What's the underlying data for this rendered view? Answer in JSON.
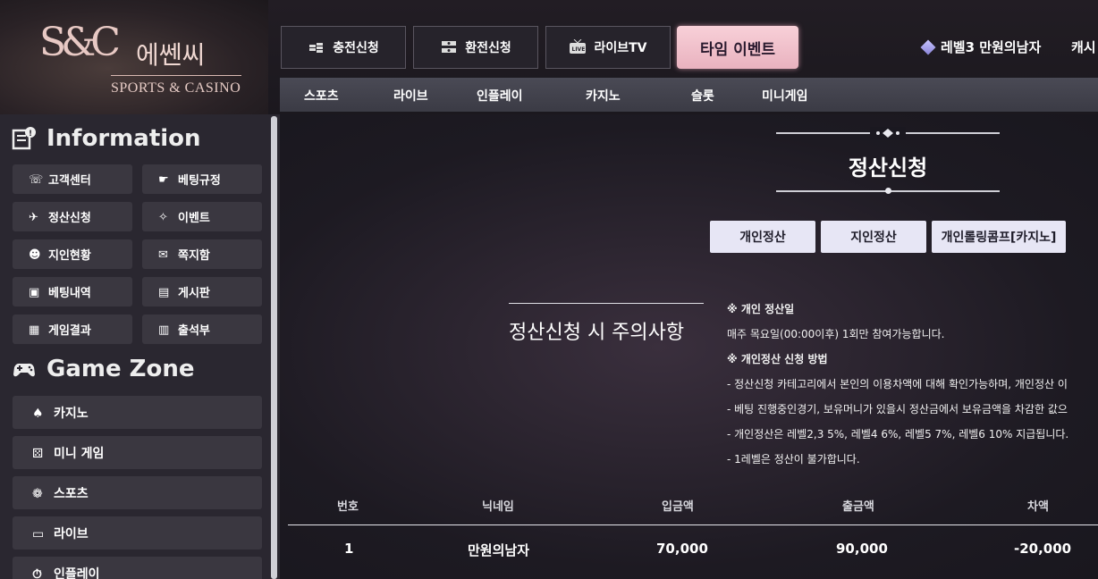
{
  "logo": {
    "mark": "S&C",
    "ko": "에쎈씨",
    "en": "SPORTS & CASINO"
  },
  "top_buttons": [
    {
      "label": "충전신청",
      "icon": "coin-stack-icon"
    },
    {
      "label": "환전신청",
      "icon": "exchange-icon"
    },
    {
      "label": "라이브TV",
      "icon": "live-tv-icon"
    }
  ],
  "time_event": "타임 이벤트",
  "user": {
    "level_name": "레벨3 만원의남자",
    "cash": "캐시"
  },
  "nav": [
    "스포츠",
    "라이브",
    "인플레이",
    "카지노",
    "슬롯",
    "미니게임"
  ],
  "sidebar": {
    "info_title": "Information",
    "info_items": [
      {
        "label": "고객센터",
        "icon": "phone-icon"
      },
      {
        "label": "베팅규정",
        "icon": "hand-icon"
      },
      {
        "label": "정산신청",
        "icon": "settlement-icon"
      },
      {
        "label": "이벤트",
        "icon": "party-icon"
      },
      {
        "label": "지인현황",
        "icon": "people-icon"
      },
      {
        "label": "쪽지함",
        "icon": "message-icon"
      },
      {
        "label": "베팅내역",
        "icon": "history-icon"
      },
      {
        "label": "게시판",
        "icon": "board-icon"
      },
      {
        "label": "게임결과",
        "icon": "result-icon"
      },
      {
        "label": "출석부",
        "icon": "calendar-icon"
      }
    ],
    "game_title": "Game Zone",
    "game_items": [
      {
        "label": "카지노",
        "icon": "spade-icon"
      },
      {
        "label": "미니 게임",
        "icon": "dice-icon"
      },
      {
        "label": "스포츠",
        "icon": "ball-icon"
      },
      {
        "label": "라이브",
        "icon": "monitor-icon"
      },
      {
        "label": "인플레이",
        "icon": "stopwatch-icon"
      }
    ]
  },
  "main": {
    "title": "정산신청",
    "tabs": [
      "개인정산",
      "지인정산",
      "개인롤링콤프[카지노]"
    ],
    "notice_head": "정산신청 시 주의사항",
    "notice_lines": [
      "※ 개인 정산일",
      "매주 목요일(00:00이후) 1회만 참여가능합니다.",
      "※ 개인정산 신청 방법",
      "- 정산신청 카테고리에서 본인의 이용차액에 대해 확인가능하며, 개인정산 이",
      "- 베팅 진행중인경기, 보유머니가 있을시 정산금에서 보유금액을 차감한 값으",
      "- 개인정산은 레벨2,3 5%, 레벨4 6%, 레벨5 7%, 레벨6 10% 지급됩니다.",
      "- 1레벨은 정산이 불가합니다."
    ],
    "table": {
      "headers": [
        "번호",
        "닉네임",
        "입금액",
        "출금액",
        "차액"
      ],
      "rows": [
        [
          "1",
          "만원의남자",
          "70,000",
          "90,000",
          "-20,000"
        ]
      ]
    }
  }
}
